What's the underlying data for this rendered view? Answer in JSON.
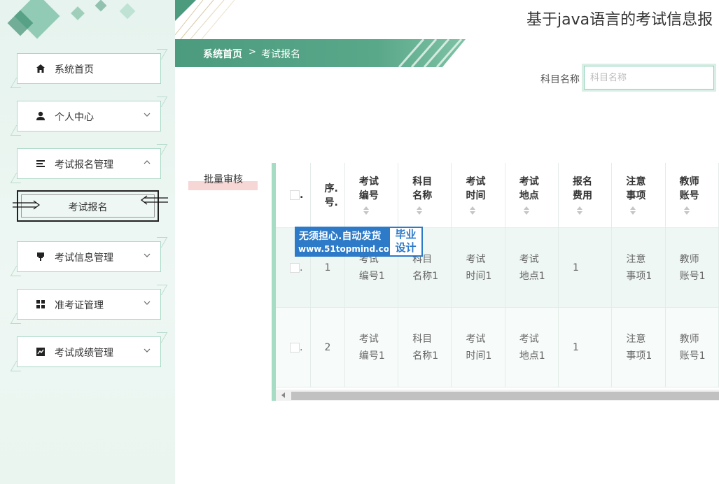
{
  "app_title": "基于java语言的考试信息报",
  "breadcrumb": {
    "home": "系统首页",
    "separator": ">",
    "current": "考试报名"
  },
  "sidebar": {
    "items": [
      {
        "label": "系统首页",
        "icon": "home-icon"
      },
      {
        "label": "个人中心",
        "icon": "user-icon",
        "chevron": "chevron-down-icon"
      },
      {
        "label": "考试报名管理",
        "icon": "list-icon",
        "chevron": "chevron-up-icon"
      },
      {
        "label": "考试信息管理",
        "icon": "pin-icon",
        "chevron": "chevron-down-icon"
      },
      {
        "label": "准考证管理",
        "icon": "grid-icon",
        "chevron": "chevron-down-icon"
      },
      {
        "label": "考试成绩管理",
        "icon": "chart-icon",
        "chevron": "chevron-down-icon"
      }
    ],
    "submenu": {
      "label": "考试报名"
    }
  },
  "search": {
    "label": "科目名称",
    "placeholder": "科目名称"
  },
  "actions": {
    "batch_review": "批量审核"
  },
  "table": {
    "checkbox_header": ".",
    "headers": [
      [
        "序.",
        "号."
      ],
      [
        "考试",
        "编号"
      ],
      [
        "科目",
        "名称"
      ],
      [
        "考试",
        "时间"
      ],
      [
        "考试",
        "地点"
      ],
      [
        "报名",
        "费用"
      ],
      [
        "注意",
        "事项"
      ],
      [
        "教师",
        "账号"
      ]
    ],
    "rows": [
      {
        "checkbox": ".",
        "index": "1",
        "exam_no": [
          "考试",
          "编号1"
        ],
        "subject": [
          "科目",
          "名称1"
        ],
        "time": [
          "考试",
          "时间1"
        ],
        "place": [
          "考试",
          "地点1"
        ],
        "fee": "1",
        "notes": [
          "注意",
          "事项1"
        ],
        "teacher": [
          "教师",
          "账号1"
        ]
      },
      {
        "checkbox": ".",
        "index": "2",
        "exam_no": [
          "考试",
          "编号1"
        ],
        "subject": [
          "科目",
          "名称1"
        ],
        "time": [
          "考试",
          "时间1"
        ],
        "place": [
          "考试",
          "地点1"
        ],
        "fee": "1",
        "notes": [
          "注意",
          "事项1"
        ],
        "teacher": [
          "教师",
          "账号1"
        ]
      }
    ]
  },
  "watermark": {
    "line1": "无须担心.自动发货",
    "line2": "www.51topmind.com",
    "right_top": "毕业",
    "right_bottom": "设计"
  },
  "colors": {
    "accent": "#4c9b7f",
    "sidebar_bg": "#e6f3ee",
    "row_bg": "#eef7f3",
    "watermark_blue": "#2d7ac8"
  }
}
